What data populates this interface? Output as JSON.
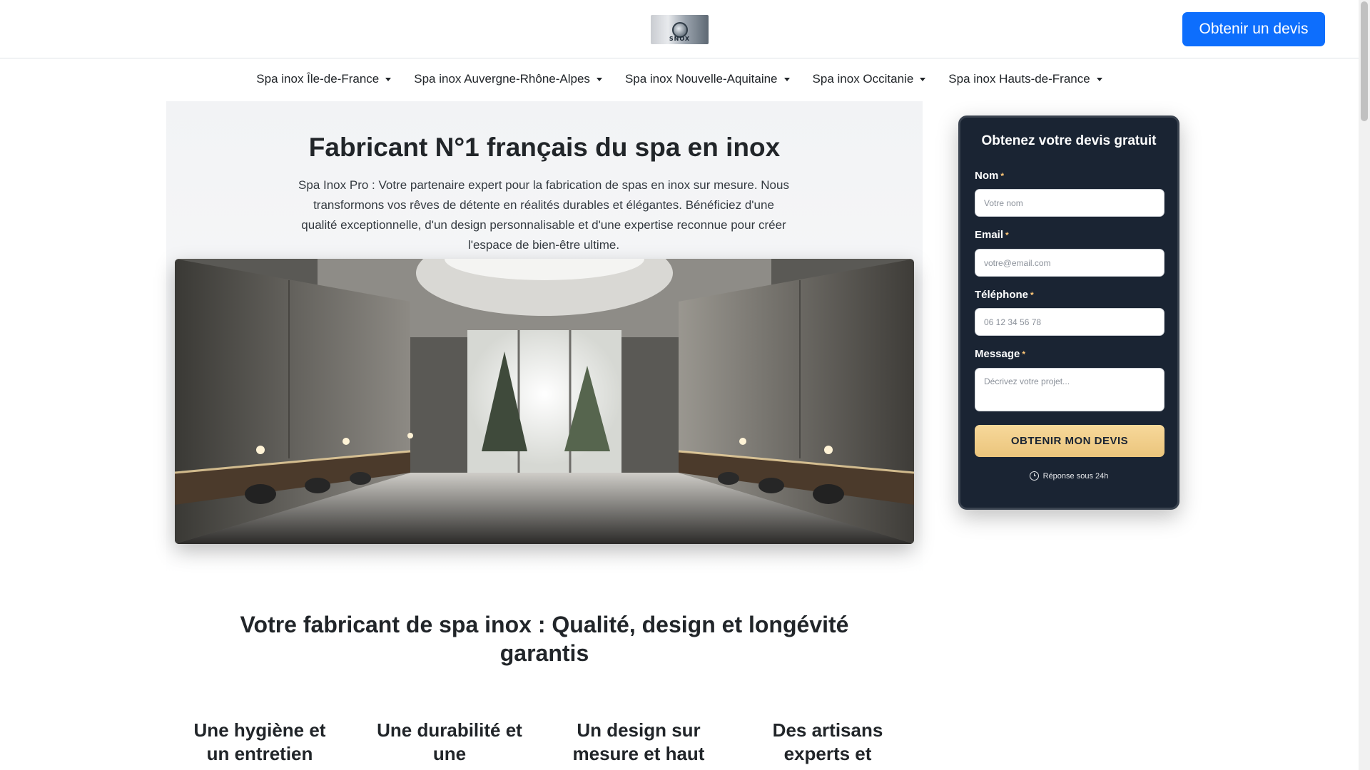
{
  "header": {
    "logo_text": "SNOX",
    "cta_label": "Obtenir un devis"
  },
  "nav": {
    "items": [
      {
        "label": "Spa inox Île-de-France"
      },
      {
        "label": "Spa inox Auvergne-Rhône-Alpes"
      },
      {
        "label": "Spa inox Nouvelle-Aquitaine"
      },
      {
        "label": "Spa inox Occitanie"
      },
      {
        "label": "Spa inox Hauts-de-France"
      }
    ]
  },
  "hero": {
    "title": "Fabricant N°1 français du spa en inox",
    "subtitle": "Spa Inox Pro : Votre partenaire expert pour la fabrication de spas en inox sur mesure. Nous transformons vos rêves de détente en réalités durables et élégantes. Bénéficiez d'une qualité exceptionnelle, d'un design personnalisable et d'une expertise reconnue pour créer l'espace de bien-être ultime."
  },
  "section": {
    "title": "Votre fabricant de spa inox : Qualité, design et longévité garantis",
    "features": [
      {
        "title": "Une hygiène et un entretien"
      },
      {
        "title": "Une durabilité et une"
      },
      {
        "title": "Un design sur mesure et haut"
      },
      {
        "title": "Des artisans experts et"
      }
    ]
  },
  "form": {
    "title": "Obtenez votre devis gratuit",
    "required_mark": "*",
    "fields": {
      "name": {
        "label": "Nom",
        "placeholder": "Votre nom"
      },
      "email": {
        "label": "Email",
        "placeholder": "votre@email.com"
      },
      "phone": {
        "label": "Téléphone",
        "placeholder": "06 12 34 56 78"
      },
      "message": {
        "label": "Message",
        "placeholder": "Décrivez votre projet..."
      }
    },
    "submit_label": "OBTENIR MON DEVIS",
    "note": "Réponse sous 24h"
  },
  "colors": {
    "primary": "#0d6efd",
    "card_bg": "#1a2433",
    "submit_gold": "#ebc57c",
    "hero_bg": "#f2f3f5"
  }
}
